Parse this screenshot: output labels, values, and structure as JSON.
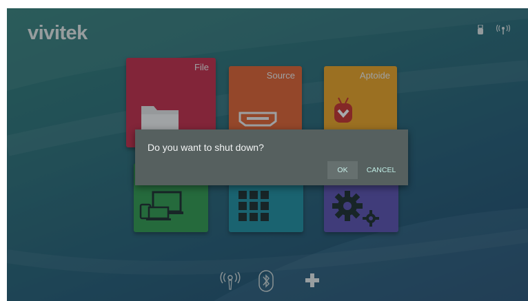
{
  "brand": {
    "logo_text": "vivitek"
  },
  "status_icons": [
    "usb-icon",
    "wireless-icon"
  ],
  "tiles": [
    {
      "label": "File",
      "icon": "folder-icon",
      "color": "#c62b47"
    },
    {
      "label": "Source",
      "icon": "hdmi-icon",
      "color": "#e2622f"
    },
    {
      "label": "Aptoide",
      "icon": "aptoide-icon",
      "color": "#eda323"
    },
    {
      "label": "",
      "icon": "screen-mirror-icon",
      "color": "#2f9a4d"
    },
    {
      "label": "",
      "icon": "apps-grid-icon",
      "color": "#1d8fa1"
    },
    {
      "label": "",
      "icon": "settings-icon",
      "color": "#5b4fb1"
    }
  ],
  "dialog": {
    "message": "Do you want to shut down?",
    "ok_label": "OK",
    "cancel_label": "CANCEL"
  },
  "dock": [
    "wifi-icon",
    "bluetooth-icon",
    "add-icon"
  ],
  "colors": {
    "dialog_bg": "#56605f",
    "accent": "#9fe8dd"
  }
}
